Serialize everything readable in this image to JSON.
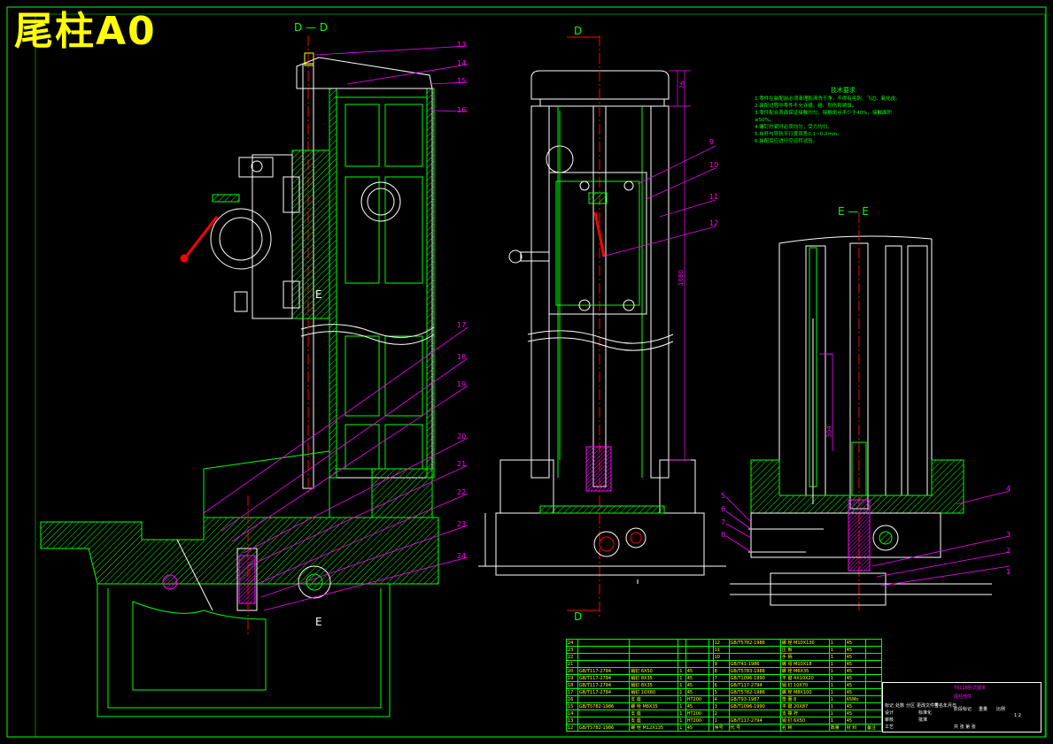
{
  "title": "尾柱A0",
  "sections": {
    "dd_top": "D — D",
    "d_arrow_top": "D",
    "d_arrow_bottom": "D",
    "ee": "E — E",
    "e_mark_1": "E",
    "e_mark_2": "E"
  },
  "part_labels": [
    "1",
    "2",
    "3",
    "4",
    "5",
    "6",
    "7",
    "8",
    "9",
    "10",
    "11",
    "12",
    "13",
    "14",
    "15",
    "16",
    "17",
    "18",
    "19",
    "20",
    "21",
    "22",
    "23",
    "24"
  ],
  "dimensions": {
    "d1": "76",
    "d2": "1080",
    "d3": "304"
  },
  "notes": {
    "heading": "技术要求",
    "items": [
      "1.零件在装配前必须清理和清洗干净，不得有毛刺、飞边、氧化皮。",
      "2.装配过程中零件不允许磕、碰、划伤和锈蚀。",
      "3.零件配合表面保证接触均匀，接触斑点不少于40%，接触面积",
      "  ≥50%。",
      "4.螺钉拧紧时必须均匀，受力均匀。",
      "5.丝杆与导轨平行度误差0.1~0.2mm。",
      "6.装配后应进行空运转试验。"
    ]
  },
  "bom_left": [
    [
      "24",
      "",
      "",
      "",
      "",
      ""
    ],
    [
      "23",
      "",
      "",
      "",
      "",
      ""
    ],
    [
      "22",
      "",
      "",
      "",
      "",
      ""
    ],
    [
      "21",
      "",
      "",
      "",
      "",
      ""
    ],
    [
      "20",
      "GB/T117-2794",
      "销钉 6X50",
      "1",
      "45",
      ""
    ],
    [
      "19",
      "GB/T117-2794",
      "销钉 8X35",
      "1",
      "45",
      ""
    ],
    [
      "18",
      "GB/T117-2794",
      "销钉 8X35",
      "1",
      "45",
      ""
    ],
    [
      "17",
      "GB/T117-2794",
      "销钉 10X60",
      "1",
      "45",
      ""
    ],
    [
      "16",
      "",
      "支 座",
      "1",
      "HT200",
      ""
    ],
    [
      "15",
      "GB/T5782-1986",
      "螺 栓 M8X35",
      "1",
      "45",
      ""
    ],
    [
      "14",
      "",
      "支 座",
      "1",
      "HT200",
      ""
    ],
    [
      "13",
      "",
      "支 座",
      "1",
      "HT200",
      ""
    ],
    [
      "12",
      "GB/T5782-1986",
      "螺 栓 M12X135",
      "1",
      "45",
      ""
    ]
  ],
  "bom_right": [
    [
      "12",
      "GB/T5782-1986",
      "螺 栓 M10X130",
      "1",
      "45",
      ""
    ],
    [
      "11",
      "",
      "压 板",
      "1",
      "45",
      ""
    ],
    [
      "10",
      "",
      "手 柄",
      "1",
      "45",
      ""
    ],
    [
      "9",
      "GB/T41-1986",
      "螺 母 M10X18",
      "1",
      "45",
      ""
    ],
    [
      "8",
      "GB/T5783-1986",
      "螺 栓 M6X35",
      "1",
      "45",
      ""
    ],
    [
      "7",
      "GB/T1096-1990",
      "平 键 4X10X20",
      "1",
      "45",
      ""
    ],
    [
      "6",
      "GB/T117-2794",
      "销 钉 10X70",
      "1",
      "45",
      ""
    ],
    [
      "5",
      "GB/T5782-1986",
      "螺 栓 M8X100",
      "1",
      "45",
      ""
    ],
    [
      "4",
      "GB/T93-1987",
      "垫 圈 8",
      "1",
      "65Mn",
      ""
    ],
    [
      "3",
      "GB/T1096-1990",
      "平 键 20X87",
      "1",
      "45",
      ""
    ],
    [
      "2",
      "",
      "支 撑 杆",
      "1",
      "45",
      ""
    ],
    [
      "1",
      "GB/T117-2794",
      "销 钉 6X50",
      "1",
      "45",
      ""
    ],
    [
      "序号",
      "代 号",
      "名 称",
      "数量",
      "材 料",
      "备注"
    ]
  ],
  "title_block": {
    "drawing_name": "T611B卧式镗床",
    "drawing_no": "尾柱部件",
    "sheet": "共 张 第 张",
    "stage": "阶段标记",
    "weight": "重量",
    "scale": "比例",
    "scale_value": "1:2",
    "row_labels": [
      "标记",
      "处数",
      "分区",
      "更改文件号",
      "签名",
      "年月日"
    ],
    "roles": [
      "设计",
      "审核",
      "工艺",
      "标准化",
      "批准"
    ]
  },
  "colors": {
    "background": "#000000",
    "outline": "#ffffff",
    "hatch": "#00ff00",
    "center_line": "#ff0000",
    "label": "#ff00ff",
    "title": "#ffff00"
  }
}
